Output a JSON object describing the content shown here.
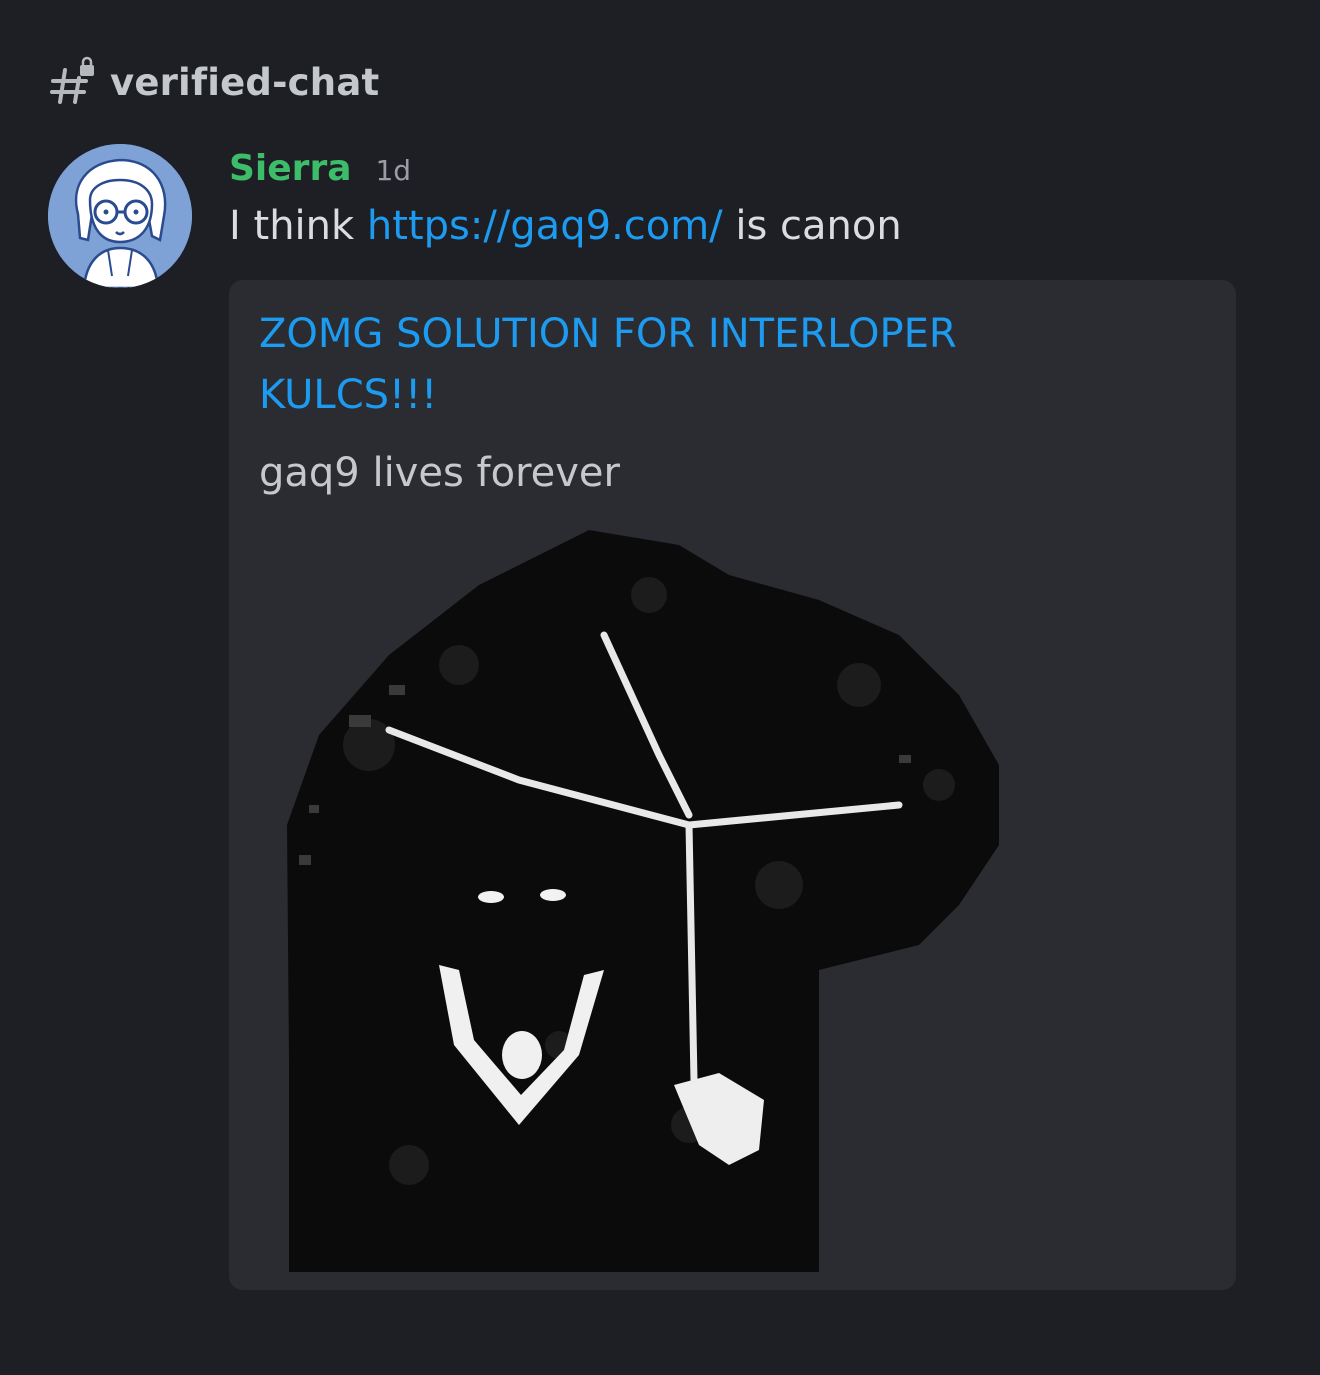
{
  "channel": {
    "icon": "hashtag-lock-icon",
    "name": "verified-chat"
  },
  "message": {
    "avatar_icon": "user-avatar",
    "username": "Sierra",
    "username_color": "#3dbd6a",
    "timestamp": "1d",
    "text_before": "I think",
    "link": "https://gaq9.com/",
    "text_after": "is canon",
    "link_color": "#1c9bf0"
  },
  "embed": {
    "title": "ZOMG SOLUTION FOR INTERLOPER KULCS!!!",
    "description": "gaq9 lives forever",
    "image_icon": "dark-creature-image"
  },
  "colors": {
    "background": "#1e1f24",
    "embed_background": "#2b2c31",
    "avatar_background": "#7ea2d6"
  }
}
